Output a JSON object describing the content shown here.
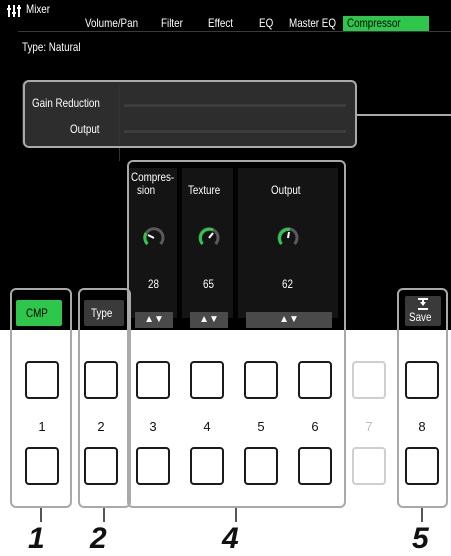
{
  "header": {
    "title": "Mixer",
    "tabs": [
      "Volume/Pan",
      "Filter",
      "Effect",
      "EQ",
      "Master EQ",
      "Compressor"
    ],
    "active_tab": "Compressor"
  },
  "type_label": "Type: Natural",
  "meters": {
    "gain_reduction": "Gain Reduction",
    "output": "Output"
  },
  "params": {
    "compression_line1": "Compres-",
    "compression_line2": "sion",
    "texture": "Texture",
    "output": "Output",
    "compression_value": "28",
    "texture_value": "65",
    "output_value": "62",
    "updown": "▲▼"
  },
  "buttons": {
    "cmp": "CMP",
    "type": "Type",
    "save": "Save"
  },
  "panel_button_numbers": [
    "1",
    "2",
    "3",
    "4",
    "5",
    "6",
    "7",
    "8"
  ],
  "callouts": [
    "1",
    "2",
    "4",
    "5"
  ],
  "colors": {
    "accent_green": "#2dc84b",
    "lcd_background": "#000000"
  }
}
